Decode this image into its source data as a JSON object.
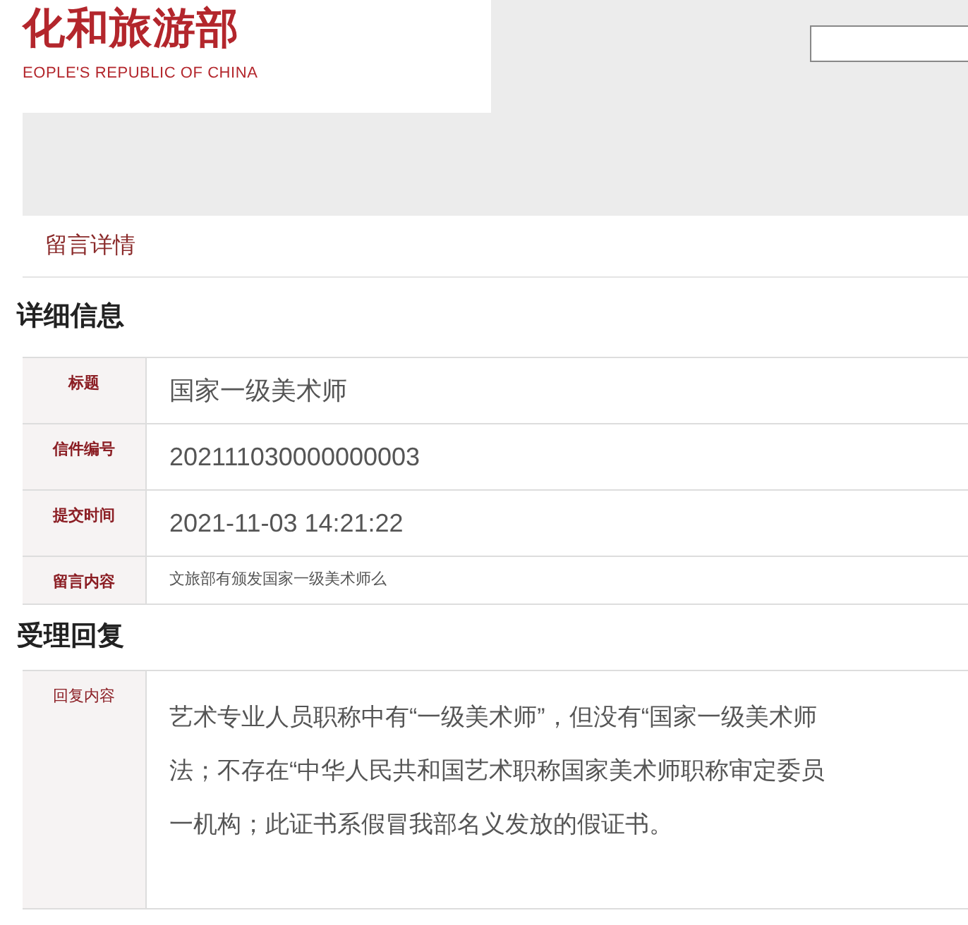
{
  "header": {
    "logo_title": "化和旅游部",
    "logo_subtitle": "EOPLE'S REPUBLIC OF CHINA"
  },
  "breadcrumb": "留言详情",
  "details": {
    "heading": "详细信息",
    "rows": [
      {
        "kind": "large",
        "label": "标题",
        "value": "国家一级美术师"
      },
      {
        "kind": "large",
        "label": "信件编号",
        "value": "202111030000000003"
      },
      {
        "kind": "large",
        "label": "提交时间",
        "value": "2021-11-03 14:21:22"
      },
      {
        "kind": "small",
        "label": "留言内容",
        "value": "文旅部有颁发国家一级美术师么"
      }
    ]
  },
  "reply": {
    "heading": "受理回复",
    "label": "回复内容",
    "lines": [
      "艺术专业人员职称中有“一级美术师”，但没有“国家一级美术师",
      "法；不存在“中华人民共和国艺术职称国家美术师职称审定委员",
      "一机构；此证书系假冒我部名义发放的假证书。"
    ]
  }
}
